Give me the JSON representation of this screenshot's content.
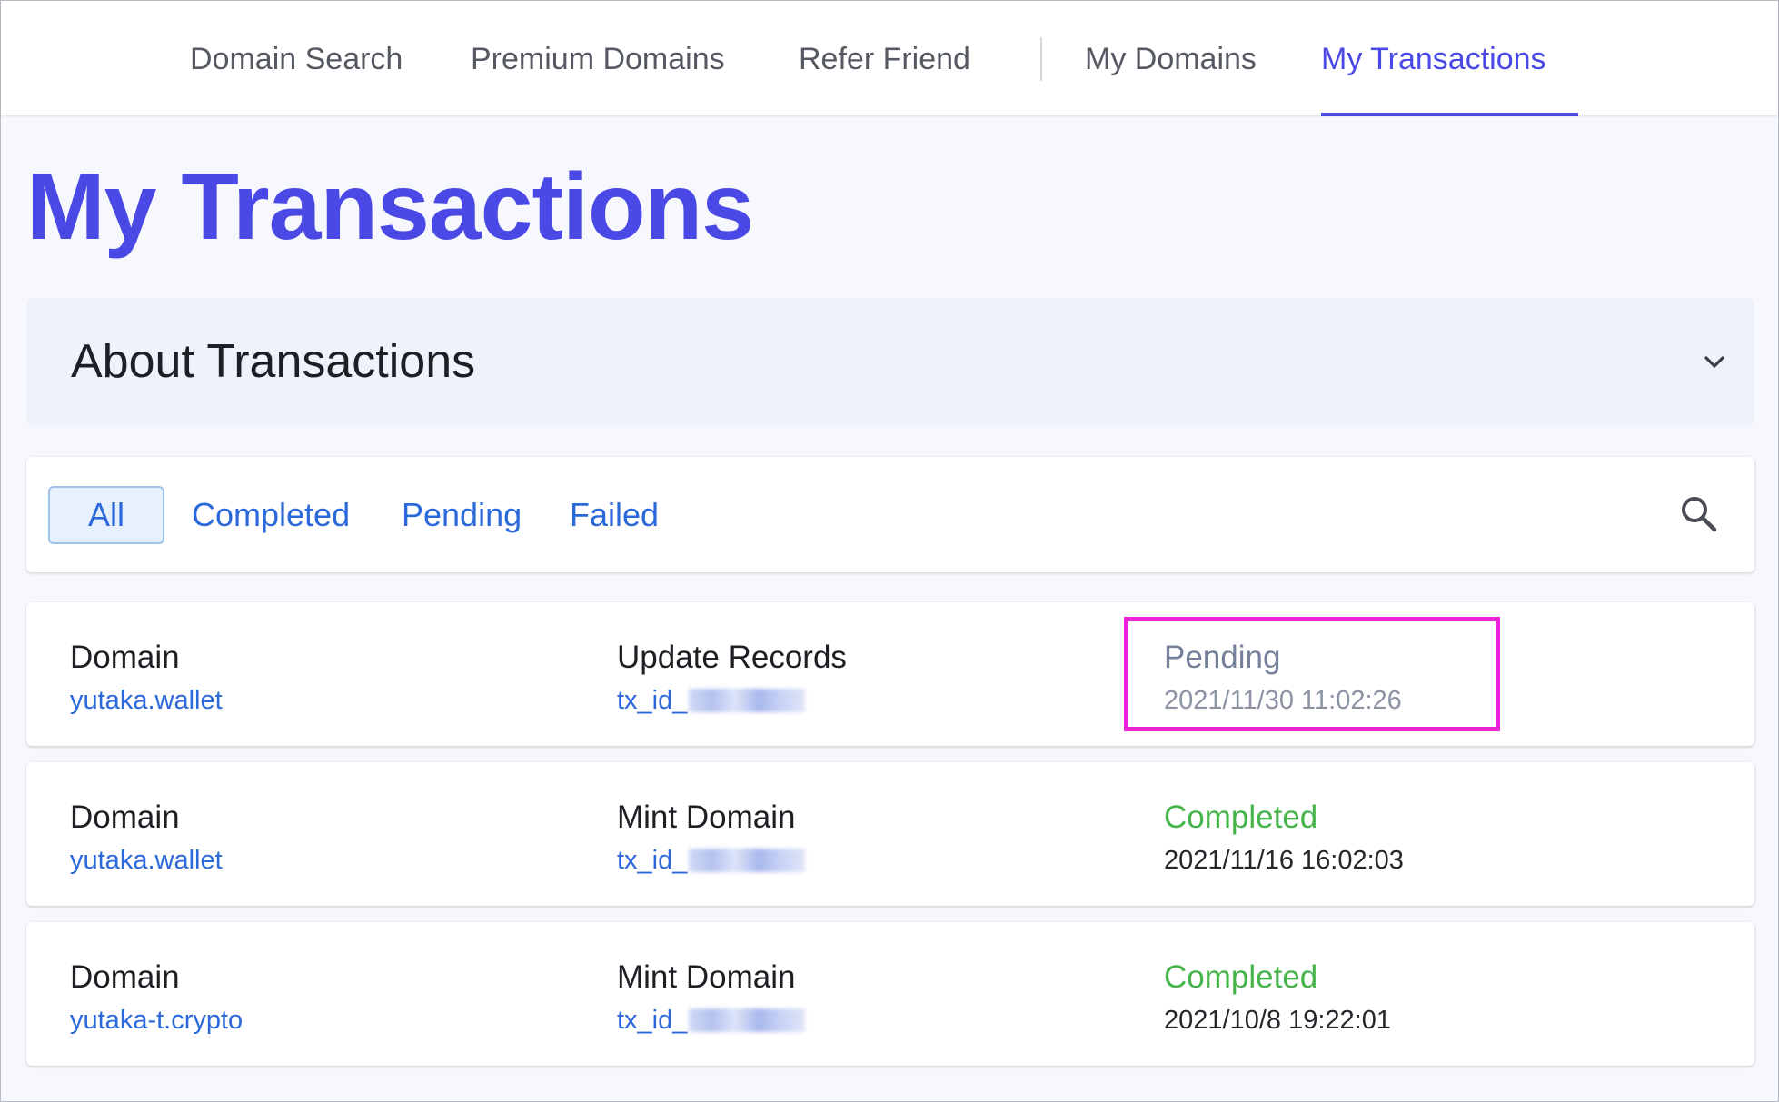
{
  "nav": {
    "items": [
      {
        "label": "Domain Search"
      },
      {
        "label": "Premium Domains"
      },
      {
        "label": "Refer Friend"
      },
      {
        "label": "My Domains"
      },
      {
        "label": "My Transactions"
      }
    ],
    "active": "My Transactions"
  },
  "page": {
    "title": "My Transactions"
  },
  "about": {
    "title": "About Transactions",
    "icon": "chevron-down-icon"
  },
  "filters": {
    "tabs": [
      "All",
      "Completed",
      "Pending",
      "Failed"
    ],
    "selected": "All",
    "search_icon": "search-icon"
  },
  "transactions": [
    {
      "type_label": "Domain",
      "domain": "yutaka.wallet",
      "action": "Update Records",
      "tx_prefix": "tx_id_",
      "status": "Pending",
      "date": "2021/11/30 11:02:26"
    },
    {
      "type_label": "Domain",
      "domain": "yutaka.wallet",
      "action": "Mint Domain",
      "tx_prefix": "tx_id_",
      "status": "Completed",
      "date": "2021/11/16 16:02:03"
    },
    {
      "type_label": "Domain",
      "domain": "yutaka-t.crypto",
      "action": "Mint Domain",
      "tx_prefix": "tx_id_",
      "status": "Completed",
      "date": "2021/10/8 19:22:01"
    }
  ],
  "colors": {
    "accent": "#4a49e6",
    "link": "#2b69da",
    "completed": "#46b44a",
    "pending": "#75809a",
    "highlight": "#ea23d8"
  }
}
